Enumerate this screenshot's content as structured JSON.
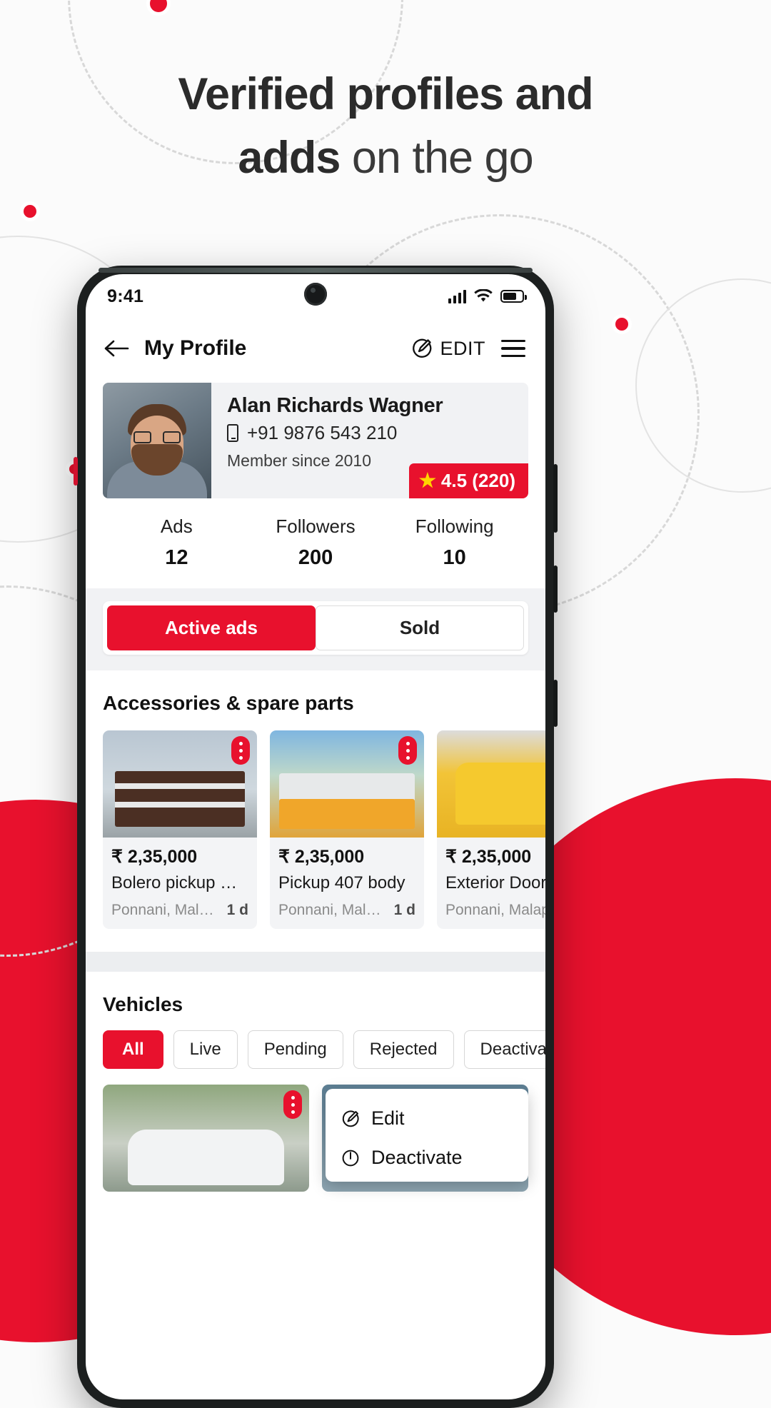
{
  "headline": {
    "bold1": "Verified profiles and",
    "bold2": "adds",
    "rest2": " on the go"
  },
  "phone": {
    "status": {
      "time": "9:41",
      "signal_icon": "signal-bars-icon",
      "wifi_icon": "wifi-icon",
      "battery_icon": "battery-icon"
    },
    "appbar": {
      "back_icon": "back-arrow-icon",
      "title": "My Profile",
      "edit_label": "EDIT",
      "edit_icon": "pencil-edit-icon",
      "menu_icon": "hamburger-menu-icon"
    },
    "profile": {
      "avatar_icon": "user-avatar-photo",
      "name": "Alan Richards Wagner",
      "phone_icon": "mobile-phone-icon",
      "phone": "+91 9876 543 210",
      "member_since": "Member since 2010",
      "rating_star_icon": "star-icon",
      "rating": "4.5 (220)"
    },
    "stats": [
      {
        "label": "Ads",
        "value": "12"
      },
      {
        "label": "Followers",
        "value": "200"
      },
      {
        "label": "Following",
        "value": "10"
      }
    ],
    "tabs": [
      {
        "label": "Active ads",
        "active": true
      },
      {
        "label": "Sold",
        "active": false
      }
    ],
    "accessories": {
      "title": "Accessories & spare parts",
      "items": [
        {
          "price": "₹ 2,35,000",
          "name": "Bolero pickup Bac...",
          "location": "Ponnani, Malapp...",
          "age": "1 d",
          "kebab_icon": "more-options-icon"
        },
        {
          "price": "₹ 2,35,000",
          "name": "Pickup 407 body",
          "location": "Ponnani, Malapp...",
          "age": "1 d",
          "kebab_icon": "more-options-icon"
        },
        {
          "price": "₹ 2,35,000",
          "name": "Exterior Door Pa",
          "location": "Ponnani, Malapp...",
          "age": "",
          "kebab_icon": "more-options-icon"
        }
      ]
    },
    "vehicles": {
      "title": "Vehicles",
      "filters": [
        {
          "label": "All",
          "active": true
        },
        {
          "label": "Live",
          "active": false
        },
        {
          "label": "Pending",
          "active": false
        },
        {
          "label": "Rejected",
          "active": false
        },
        {
          "label": "Deactivated",
          "active": false
        }
      ],
      "menu": [
        {
          "label": "Edit",
          "icon": "pencil-edit-icon"
        },
        {
          "label": "Deactivate",
          "icon": "deactivate-icon"
        }
      ],
      "kebab_icon": "more-options-icon"
    }
  },
  "colors": {
    "accent": "#e8112d",
    "star": "#ffd400",
    "text": "#111111"
  }
}
